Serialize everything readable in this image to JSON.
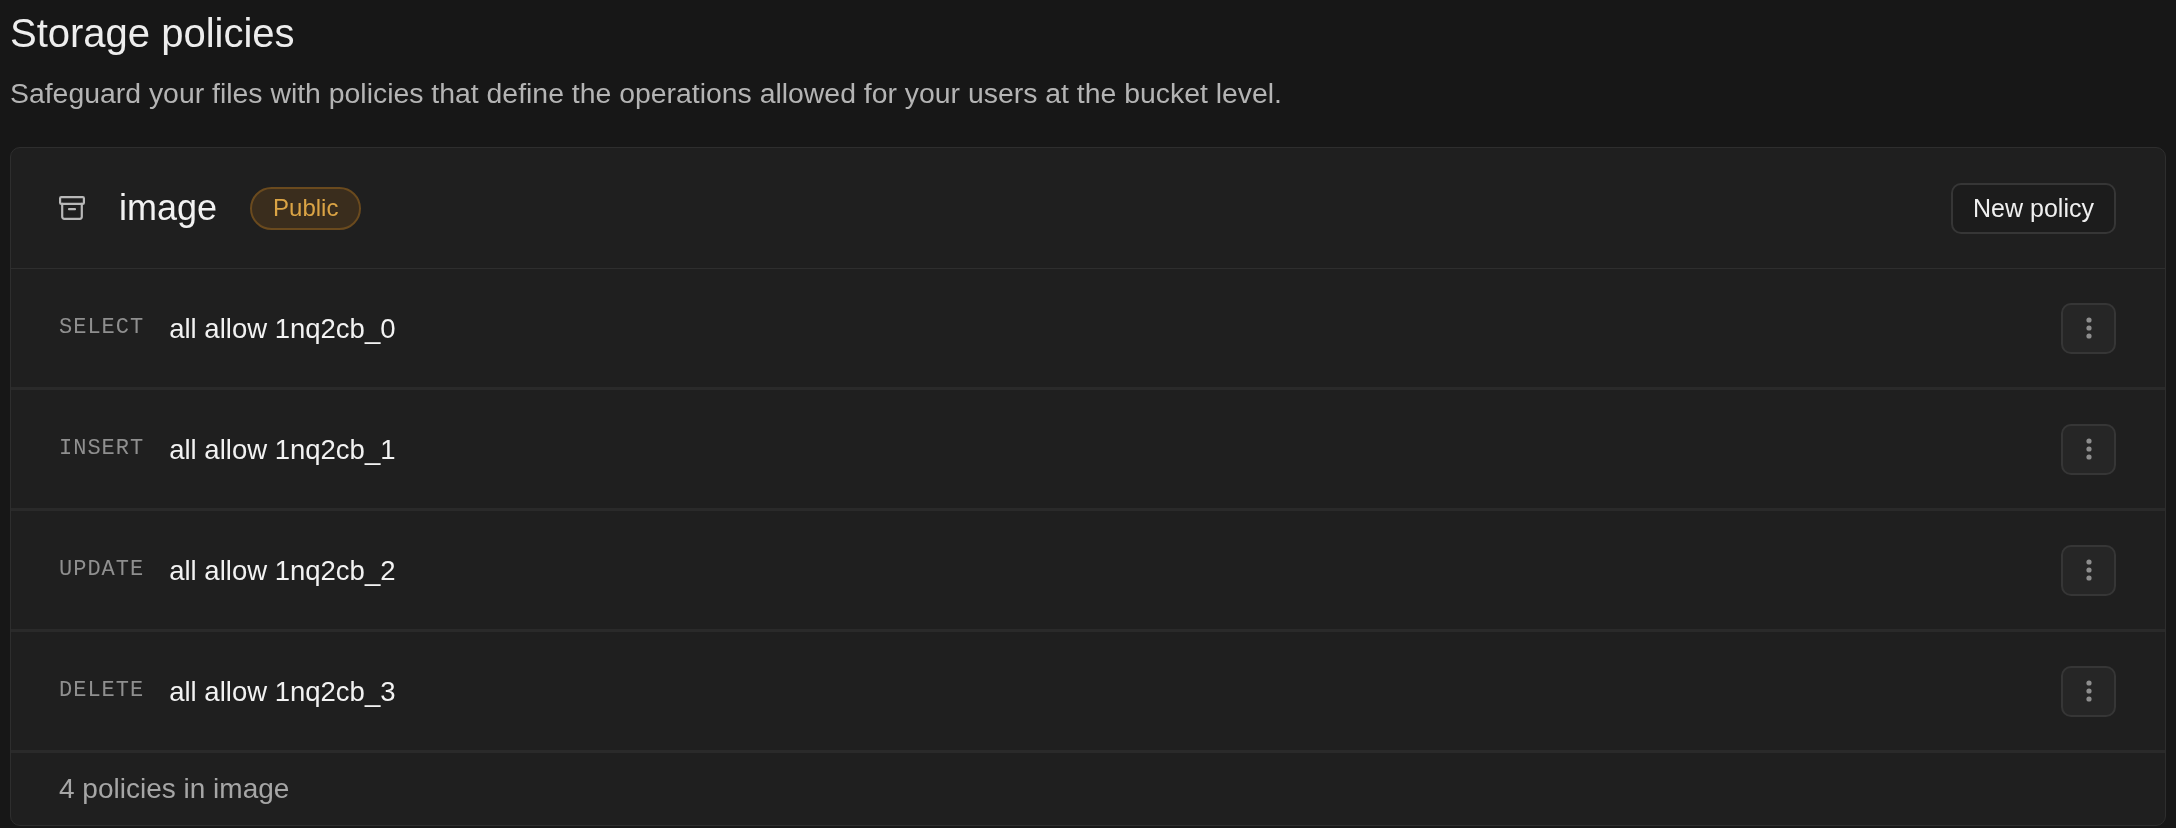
{
  "page": {
    "title": "Storage policies",
    "description": "Safeguard your files with policies that define the operations allowed for your users at the bucket level."
  },
  "bucket": {
    "name": "image",
    "badge": "Public",
    "new_policy_button": "New policy"
  },
  "policies": [
    {
      "command": "SELECT",
      "name": "all allow 1nq2cb_0"
    },
    {
      "command": "INSERT",
      "name": "all allow 1nq2cb_1"
    },
    {
      "command": "UPDATE",
      "name": "all allow 1nq2cb_2"
    },
    {
      "command": "DELETE",
      "name": "all allow 1nq2cb_3"
    }
  ],
  "footer": "4 policies in image"
}
